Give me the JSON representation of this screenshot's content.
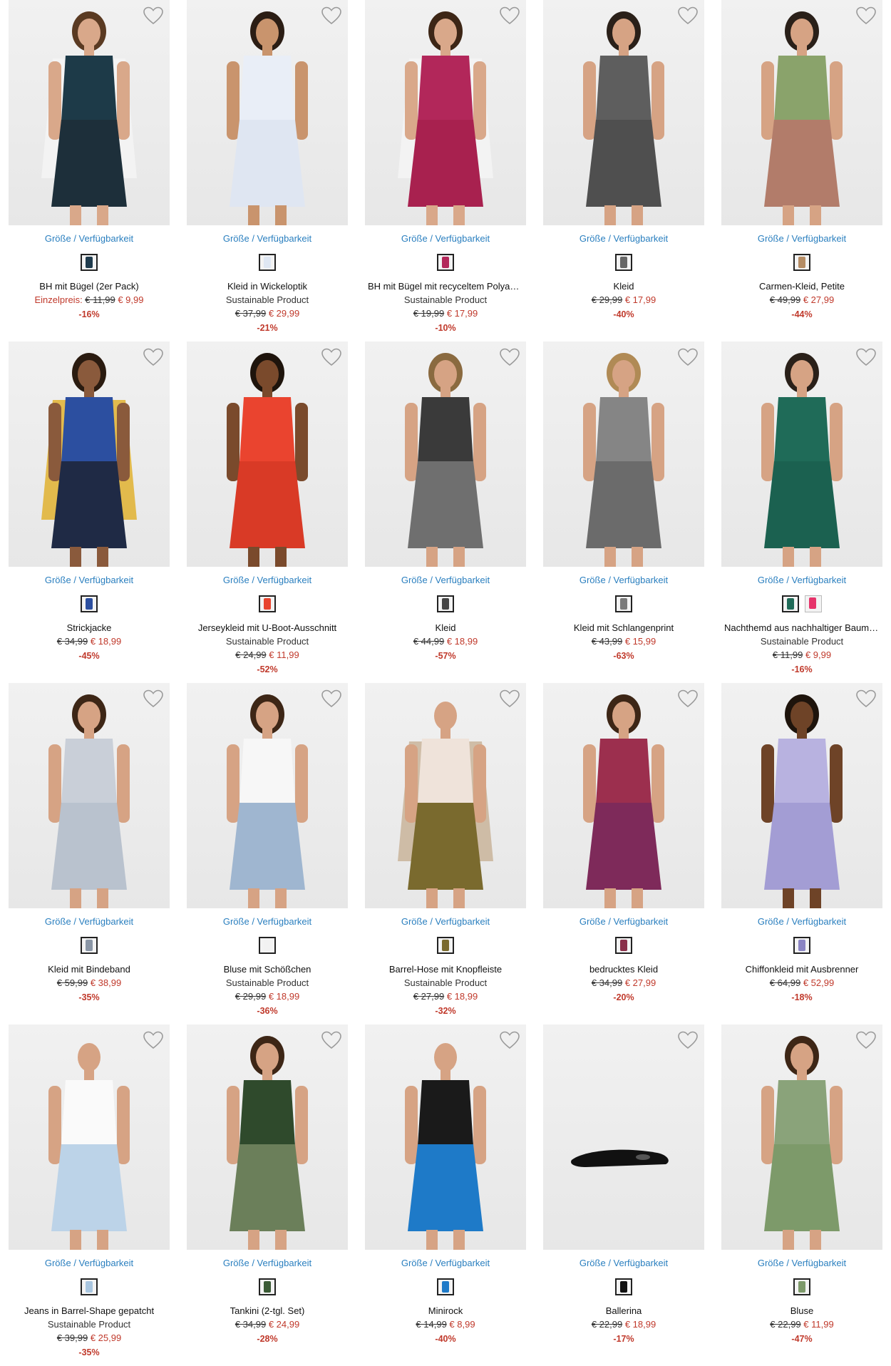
{
  "colors": {
    "link": "#2a7fbf",
    "sale": "#c0392b",
    "text": "#111111"
  },
  "size_link_label": "Größe / Verfügbarkeit",
  "price_prefix_label": "Einzelpreis:",
  "products": [
    {
      "title": "BH mit Bügel (2er Pack)",
      "sub": "",
      "prefix": "Einzelpreis:",
      "old": "€ 11,99",
      "new": "€ 9,99",
      "discount": "-16%",
      "swatches": [
        "#1f3b4d"
      ],
      "photo": {
        "top": "#1d3a48",
        "bottom": "#1d2f3a",
        "skin": "#d9a88a",
        "hair": "#5a3a22",
        "coat": "#f5f5f5"
      }
    },
    {
      "title": "Kleid in Wickeloptik",
      "sub": "Sustainable Product",
      "prefix": "",
      "old": "€ 37,99",
      "new": "€ 29,99",
      "discount": "-21%",
      "swatches": [
        "#dfe7f3"
      ],
      "photo": {
        "top": "#e9eef7",
        "bottom": "#dfe6f2",
        "skin": "#c9946d",
        "hair": "#2b1d14",
        "coat": ""
      }
    },
    {
      "title": "BH mit Bügel mit recyceltem Polyamid",
      "sub": "Sustainable Product",
      "prefix": "",
      "old": "€ 19,99",
      "new": "€ 17,99",
      "discount": "-10%",
      "swatches": [
        "#b3275a"
      ],
      "photo": {
        "top": "#b2275a",
        "bottom": "#a8214f",
        "skin": "#d9a88a",
        "hair": "#3d2616",
        "coat": "#f5f5f5"
      }
    },
    {
      "title": "Kleid",
      "sub": "",
      "prefix": "",
      "old": "€ 29,99",
      "new": "€ 17,99",
      "discount": "-40%",
      "swatches": [
        "#666666"
      ],
      "photo": {
        "top": "#5e5e5e",
        "bottom": "#4f4f4f",
        "skin": "#d6a384",
        "hair": "#2a2019",
        "coat": ""
      }
    },
    {
      "title": "Carmen-Kleid, Petite",
      "sub": "",
      "prefix": "",
      "old": "€ 49,99",
      "new": "€ 27,99",
      "discount": "-44%",
      "swatches": [
        "#b58c64"
      ],
      "photo": {
        "top": "#8aa36b",
        "bottom": "#b27c6a",
        "skin": "#d6a384",
        "hair": "#2a2019",
        "coat": ""
      }
    },
    {
      "title": "Strickjacke",
      "sub": "",
      "prefix": "",
      "old": "€ 34,99",
      "new": "€ 18,99",
      "discount": "-45%",
      "swatches": [
        "#2c4fa0"
      ],
      "photo": {
        "top": "#2c4fa0",
        "bottom": "#1f2a45",
        "skin": "#8a5a3c",
        "hair": "#2a1b10",
        "coat": "#e0b130"
      }
    },
    {
      "title": "Jerseykleid mit U-Boot-Ausschnitt",
      "sub": "Sustainable Product",
      "prefix": "",
      "old": "€ 24,99",
      "new": "€ 11,99",
      "discount": "-52%",
      "swatches": [
        "#e8442e"
      ],
      "photo": {
        "top": "#ea442f",
        "bottom": "#d93a26",
        "skin": "#7a4a2c",
        "hair": "#1e140c",
        "coat": ""
      }
    },
    {
      "title": "Kleid",
      "sub": "",
      "prefix": "",
      "old": "€ 44,99",
      "new": "€ 18,99",
      "discount": "-57%",
      "swatches": [
        "#444444"
      ],
      "photo": {
        "top": "#3a3a3a",
        "bottom": "#6f6f6f",
        "skin": "#d6a384",
        "hair": "#8a6a40",
        "coat": ""
      }
    },
    {
      "title": "Kleid mit Schlangenprint",
      "sub": "",
      "prefix": "",
      "old": "€ 43,99",
      "new": "€ 15,99",
      "discount": "-63%",
      "swatches": [
        "#7a7a7a"
      ],
      "photo": {
        "top": "#858585",
        "bottom": "#6b6b6b",
        "skin": "#d6a384",
        "hair": "#b08a55",
        "coat": ""
      }
    },
    {
      "title": "Nachthemd aus nachhaltiger Baumwolle",
      "sub": "Sustainable Product",
      "prefix": "",
      "old": "€ 11,99",
      "new": "€ 9,99",
      "discount": "-16%",
      "swatches": [
        "#1f6b58",
        "#e6336a"
      ],
      "photo": {
        "top": "#1f6b58",
        "bottom": "#1b6150",
        "skin": "#d6a384",
        "hair": "#2a2019",
        "coat": ""
      }
    },
    {
      "title": "Kleid mit Bindeband",
      "sub": "",
      "prefix": "",
      "old": "€ 59,99",
      "new": "€ 38,99",
      "discount": "-35%",
      "swatches": [
        "#8a96a6"
      ],
      "photo": {
        "top": "#c9cfd8",
        "bottom": "#b9c2ce",
        "skin": "#d6a384",
        "hair": "#3d2616",
        "coat": ""
      }
    },
    {
      "title": "Bluse mit Schößchen",
      "sub": "Sustainable Product",
      "prefix": "",
      "old": "€ 29,99",
      "new": "€ 18,99",
      "discount": "-36%",
      "swatches": [
        "#f2f2f2"
      ],
      "photo": {
        "top": "#f7f7f7",
        "bottom": "#9fb6d0",
        "skin": "#d6a384",
        "hair": "#3d2616",
        "coat": ""
      }
    },
    {
      "title": "Barrel-Hose mit Knopfleiste",
      "sub": "Sustainable Product",
      "prefix": "",
      "old": "€ 27,99",
      "new": "€ 18,99",
      "discount": "-32%",
      "swatches": [
        "#7a6a2e"
      ],
      "photo": {
        "top": "#efe3da",
        "bottom": "#7a6a2e",
        "skin": "#d6a384",
        "hair": "",
        "coat": "#c9b49a"
      }
    },
    {
      "title": "bedrucktes Kleid",
      "sub": "",
      "prefix": "",
      "old": "€ 34,99",
      "new": "€ 27,99",
      "discount": "-20%",
      "swatches": [
        "#8a2f4a"
      ],
      "photo": {
        "top": "#9c2f4e",
        "bottom": "#7e2a5a",
        "skin": "#d6a384",
        "hair": "#3d2616",
        "coat": ""
      }
    },
    {
      "title": "Chiffonkleid mit Ausbrenner",
      "sub": "",
      "prefix": "",
      "old": "€ 64,99",
      "new": "€ 52,99",
      "discount": "-18%",
      "swatches": [
        "#8b85c4"
      ],
      "photo": {
        "top": "#b8b2e0",
        "bottom": "#a39dd4",
        "skin": "#6e4327",
        "hair": "#1e140c",
        "coat": ""
      }
    },
    {
      "title": "Jeans in Barrel-Shape gepatcht",
      "sub": "Sustainable Product",
      "prefix": "",
      "old": "€ 39,99",
      "new": "€ 25,99",
      "discount": "-35%",
      "swatches": [
        "#a9c6e0"
      ],
      "photo": {
        "top": "#fafafa",
        "bottom": "#bcd3e8",
        "skin": "#d6a384",
        "hair": "",
        "coat": ""
      }
    },
    {
      "title": "Tankini (2-tgl. Set)",
      "sub": "",
      "prefix": "",
      "old": "€ 34,99",
      "new": "€ 24,99",
      "discount": "-28%",
      "swatches": [
        "#3a5a35"
      ],
      "photo": {
        "top": "#2f4a2c",
        "bottom": "#6b7f5a",
        "skin": "#d6a384",
        "hair": "#3d2616",
        "coat": ""
      }
    },
    {
      "title": "Minirock",
      "sub": "",
      "prefix": "",
      "old": "€ 14,99",
      "new": "€ 8,99",
      "discount": "-40%",
      "swatches": [
        "#1e7ac8"
      ],
      "photo": {
        "top": "#1a1a1a",
        "bottom": "#1e7ac8",
        "skin": "#d6a384",
        "hair": "",
        "coat": ""
      }
    },
    {
      "title": "Ballerina",
      "sub": "",
      "prefix": "",
      "old": "€ 22,99",
      "new": "€ 18,99",
      "discount": "-17%",
      "swatches": [
        "#111111"
      ],
      "photo": {
        "top": "",
        "bottom": "",
        "skin": "",
        "hair": "",
        "coat": "",
        "shoe": true
      }
    },
    {
      "title": "Bluse",
      "sub": "",
      "prefix": "",
      "old": "€ 22,99",
      "new": "€ 11,99",
      "discount": "-47%",
      "swatches": [
        "#7d9a6a"
      ],
      "photo": {
        "top": "#8aa37a",
        "bottom": "#7d9a6a",
        "skin": "#d6a384",
        "hair": "#3d2616",
        "coat": ""
      }
    }
  ]
}
